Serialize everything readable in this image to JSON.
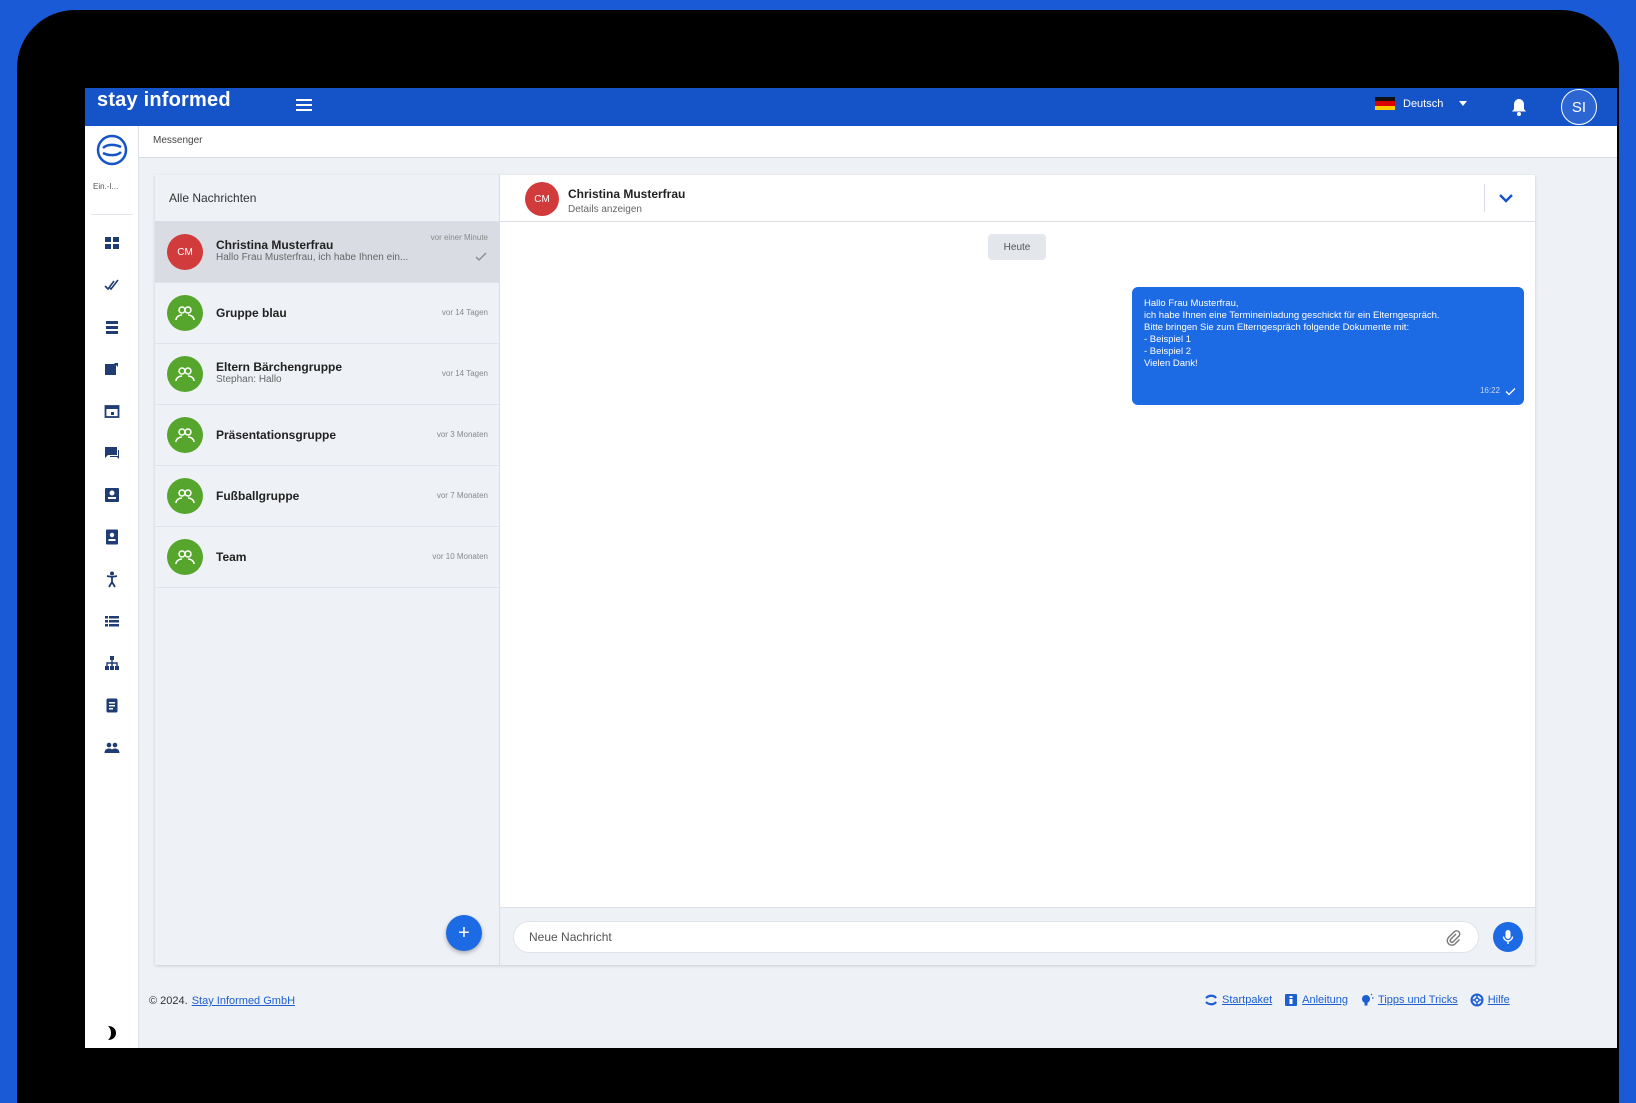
{
  "app": {
    "logo_text": "stay informed"
  },
  "topbar": {
    "language": "Deutsch",
    "user_initials": "SI"
  },
  "rail": {
    "org_label": "Ein.-I..."
  },
  "breadcrumb": "Messenger",
  "conversations": {
    "heading": "Alle Nachrichten",
    "items": [
      {
        "initials": "CM",
        "name": "Christina Musterfrau",
        "preview": "Hallo Frau Musterfrau, ich habe Ihnen ein...",
        "time": "vor einer Minute"
      },
      {
        "name": "Gruppe blau",
        "preview": "",
        "time": "vor 14 Tagen"
      },
      {
        "name": "Eltern Bärchengruppe",
        "preview": "Stephan: Hallo",
        "time": "vor 14 Tagen"
      },
      {
        "name": "Präsentationsgruppe",
        "preview": "",
        "time": "vor 3 Monaten"
      },
      {
        "name": "Fußballgruppe",
        "preview": "",
        "time": "vor 7 Monaten"
      },
      {
        "name": "Team",
        "preview": "",
        "time": "vor 10 Monaten"
      }
    ],
    "fab_label": "+"
  },
  "chat": {
    "initials": "CM",
    "name": "Christina Musterfrau",
    "details_link": "Details anzeigen",
    "day_label": "Heute",
    "message": {
      "lines": [
        "Hallo Frau Musterfrau,",
        "",
        "ich habe Ihnen eine Termineinladung geschickt für ein Elterngespräch.",
        "Bitte bringen Sie zum Elterngespräch folgende Dokumente mit:",
        "- Beispiel 1",
        "- Beispiel 2",
        "",
        "Vielen Dank!"
      ],
      "time": "16:22"
    },
    "composer_placeholder": "Neue Nachricht"
  },
  "footer": {
    "copyright": "© 2024.",
    "company": "Stay Informed GmbH",
    "links": [
      "Startpaket",
      "Anleitung",
      "Tipps und Tricks",
      "Hilfe"
    ]
  },
  "colors": {
    "brand": "#1553c8",
    "accent": "#1d6ae5",
    "avatar_red": "#d23b3b",
    "avatar_green": "#56a62d"
  }
}
